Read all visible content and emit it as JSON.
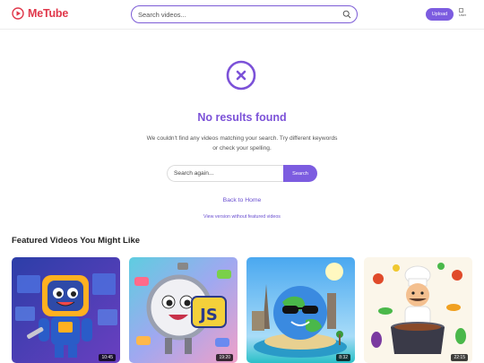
{
  "header": {
    "brand": "MeTube",
    "search_placeholder": "Search videos...",
    "upload_label": "Upload",
    "avatar_alt": "User"
  },
  "no_results": {
    "title": "No results found",
    "message": "We couldn't find any videos matching your search. Try different keywords or check your spelling.",
    "search_placeholder": "Search again...",
    "search_button": "Search",
    "back_link": "Back to Home",
    "view_link": "View version without featured videos"
  },
  "featured": {
    "title": "Featured Videos You Might Like",
    "videos": [
      {
        "thumbnail": "robot-mascot-with-wrench",
        "duration": "10:45"
      },
      {
        "thumbnail": "clock-with-javascript-badge",
        "duration": "19:20"
      },
      {
        "thumbnail": "globe-with-sunglasses-landmarks",
        "duration": "8:32"
      },
      {
        "thumbnail": "chef-cooking-vegetables",
        "duration": "22:15"
      }
    ]
  },
  "colors": {
    "brand": "#e0384b",
    "accent": "#7c5ce0",
    "title": "#7c52d8"
  }
}
